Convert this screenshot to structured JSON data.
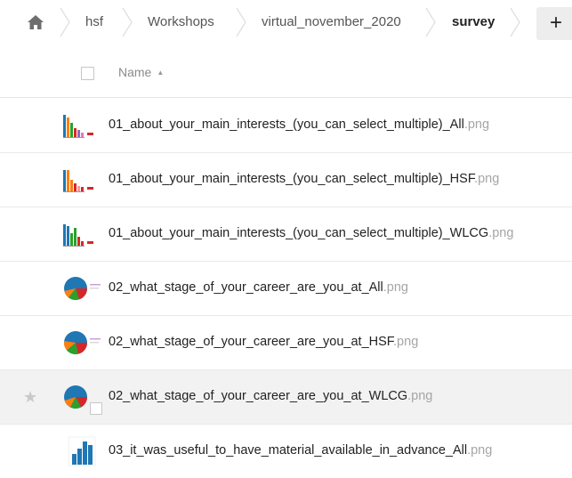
{
  "breadcrumb": {
    "home_icon": "home-icon",
    "items": [
      "hsf",
      "Workshops",
      "virtual_november_2020",
      "survey"
    ]
  },
  "toolbar": {
    "new_label": "+"
  },
  "list_header": {
    "name_label": "Name",
    "sort_indicator": "▲"
  },
  "files": [
    {
      "name": "01_about_your_main_interests_(you_can_select_multiple)_All",
      "ext": ".png",
      "thumb": "bar-chart-thumbnail"
    },
    {
      "name": "01_about_your_main_interests_(you_can_select_multiple)_HSF",
      "ext": ".png",
      "thumb": "bar-chart-thumbnail"
    },
    {
      "name": "01_about_your_main_interests_(you_can_select_multiple)_WLCG",
      "ext": ".png",
      "thumb": "bar-chart-thumbnail"
    },
    {
      "name": "02_what_stage_of_your_career_are_you_at_All",
      "ext": ".png",
      "thumb": "pie-chart-thumbnail"
    },
    {
      "name": "02_what_stage_of_your_career_are_you_at_HSF",
      "ext": ".png",
      "thumb": "pie-chart-thumbnail"
    },
    {
      "name": "02_what_stage_of_your_career_are_you_at_WLCG",
      "ext": ".png",
      "thumb": "pie-chart-thumbnail",
      "selected": true
    },
    {
      "name": "03_it_was_useful_to_have_material_available_in_advance_All",
      "ext": ".png",
      "thumb": "histogram-thumbnail"
    }
  ],
  "colors": {
    "star": "#c9c9c9",
    "row_hover": "#f2f2f2",
    "ext_gray": "#a5a5a5"
  }
}
